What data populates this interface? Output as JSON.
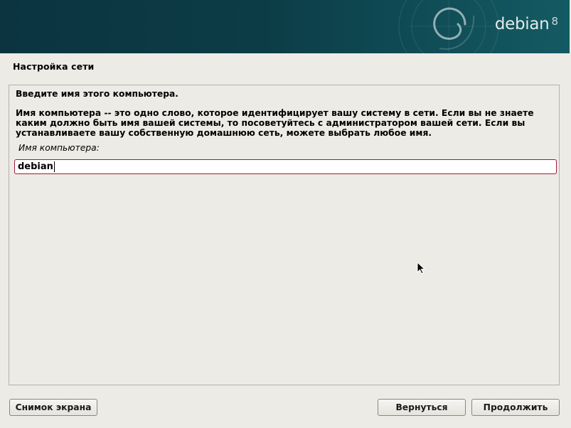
{
  "banner": {
    "logo_text": "debian",
    "logo_version": "8"
  },
  "step_title": "Настройка сети",
  "main": {
    "heading": "Введите имя этого компьютера.",
    "description_lines": [
      "Имя компьютера -- это одно слово, которое идентифицирует вашу систему в сети. Если вы не знаете",
      "каким должно быть имя вашей системы, то посоветуйтесь с администратором вашей сети. Если вы",
      "устанавливаете вашу собственную домашнюю сеть, можете выбрать любое имя."
    ],
    "field_label": "Имя компьютера:",
    "hostname_value": "debian"
  },
  "buttons": {
    "screenshot_label": "Снимок экрана",
    "back_label": "Вернуться",
    "continue_label": "Продолжить"
  },
  "colors": {
    "banner": "#0c3c46",
    "background": "#edebe6",
    "input_border": "#a0183e"
  },
  "icons": {
    "logo_swirl": "debian-swirl-icon",
    "pointer": "mouse-cursor-icon"
  }
}
